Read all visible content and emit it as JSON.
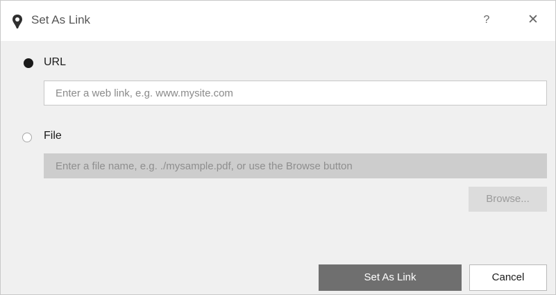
{
  "window": {
    "title": "Set As Link",
    "help_label": "?",
    "close_label": "✕",
    "icon": "pin-icon"
  },
  "url_option": {
    "label": "URL",
    "selected": true,
    "input_value": "",
    "input_placeholder": "Enter a web link, e.g. www.mysite.com"
  },
  "file_option": {
    "label": "File",
    "selected": false,
    "input_value": "",
    "input_placeholder": "Enter a file name, e.g. ./mysample.pdf, or use the Browse button",
    "browse_label": "Browse..."
  },
  "actions": {
    "confirm_label": "Set As Link",
    "cancel_label": "Cancel"
  },
  "colors": {
    "primary_button": "#6f6f6f",
    "disabled_field": "#cdcdcd"
  }
}
